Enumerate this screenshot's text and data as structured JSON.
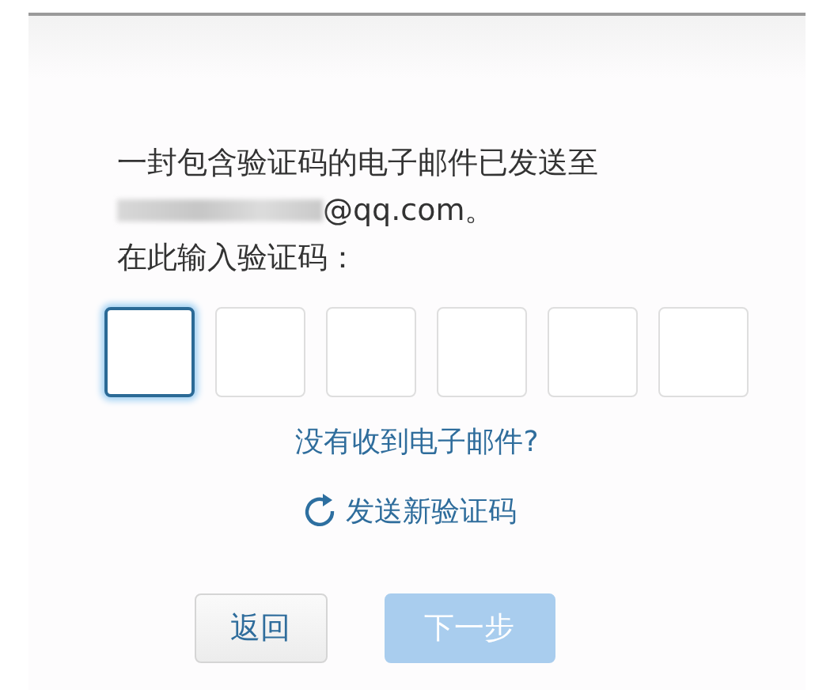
{
  "message": {
    "line": "一封包含验证码的电子邮件已发送至",
    "email_redacted": true,
    "email": "@qq.com。",
    "prompt": "在此输入验证码："
  },
  "code_boxes": [
    {
      "focused": true
    },
    {
      "focused": false
    },
    {
      "focused": false
    },
    {
      "focused": false
    },
    {
      "focused": false
    },
    {
      "focused": false
    }
  ],
  "no_email_link": "没有收到电子邮件?",
  "resend_link": "发送新验证码",
  "buttons": [
    {
      "label": "返回",
      "disabled": false
    },
    {
      "label": "下一步",
      "disabled": true
    }
  ]
}
